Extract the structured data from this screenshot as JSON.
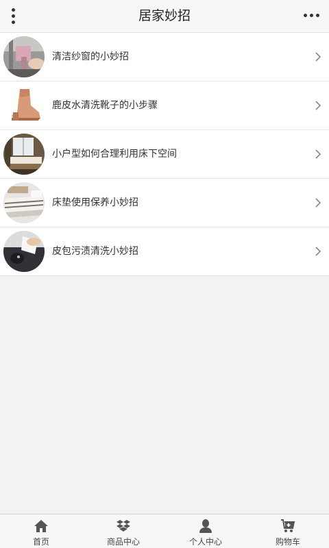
{
  "header": {
    "title": "居家妙招",
    "menu_icon": "kebab-menu-icon",
    "more_icon": "more-dots-icon"
  },
  "list": {
    "items": [
      {
        "label": "清洁纱窗的小妙招",
        "image": "window-cleaning-photo"
      },
      {
        "label": "鹿皮水清洗靴子的小步骤",
        "image": "suede-boot-photo"
      },
      {
        "label": "小户型如何合理利用床下空间",
        "image": "small-bedroom-photo"
      },
      {
        "label": "床垫使用保养小妙招",
        "image": "mattress-photo"
      },
      {
        "label": "皮包污渍清洗小妙招",
        "image": "leather-bag-photo"
      }
    ]
  },
  "tabbar": {
    "items": [
      {
        "label": "首页",
        "icon": "home-icon"
      },
      {
        "label": "商品中心",
        "icon": "box-icon"
      },
      {
        "label": "个人中心",
        "icon": "user-icon"
      },
      {
        "label": "购物车",
        "icon": "cart-icon"
      }
    ]
  },
  "colors": {
    "background": "#f2f2f2",
    "header_bg": "#f7f7f7",
    "text": "#333333",
    "icon": "#555555"
  }
}
